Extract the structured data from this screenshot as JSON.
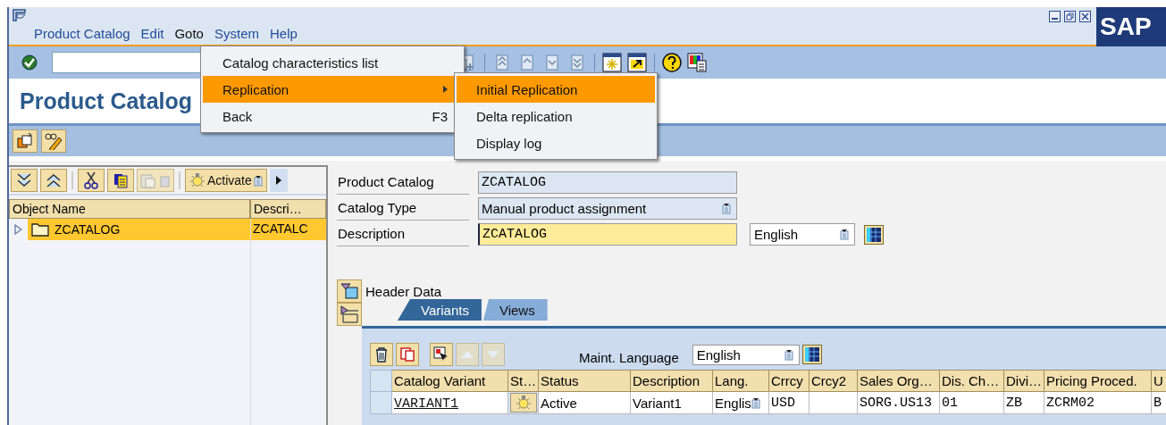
{
  "menu_bar": [
    {
      "label": "Product Catalog",
      "selected": false
    },
    {
      "label": "Edit",
      "selected": false
    },
    {
      "label": "Goto",
      "selected": true
    },
    {
      "label": "System",
      "selected": false
    },
    {
      "label": "Help",
      "selected": false
    }
  ],
  "goto_menu": [
    {
      "label": "Catalog characteristics list",
      "selected": false
    },
    {
      "label": "Replication",
      "selected": true,
      "kind": "submenu"
    },
    {
      "label": "Back",
      "shortcut": "F3",
      "selected": false
    }
  ],
  "replication_menu": [
    {
      "label": "Initial Replication",
      "selected": true
    },
    {
      "label": "Delta replication",
      "selected": false
    },
    {
      "label": "Display log",
      "selected": false
    }
  ],
  "logo": "SAP",
  "page_title": "Product Catalog",
  "tree": {
    "toolbar_button": "Activate",
    "columns": [
      "Object Name",
      "Descri…"
    ],
    "rows": [
      {
        "name": "ZCATALOG",
        "description": "ZCATALC",
        "selected": true,
        "expanded": false
      }
    ]
  },
  "form": [
    {
      "label": "Product Catalog",
      "value": "ZCATALOG",
      "kind": "display"
    },
    {
      "label": "Catalog Type",
      "value": "Manual product assignment",
      "kind": "dropdown"
    },
    {
      "label": "Description",
      "value": "ZCATALOG",
      "kind": "input",
      "language": "English"
    }
  ],
  "header_data": "Header Data",
  "tabs": [
    {
      "label": "Variants",
      "selected": true
    },
    {
      "label": "Views",
      "selected": false
    }
  ],
  "maint_language": {
    "label": "Maint. Language",
    "value": "English"
  },
  "table": {
    "columns": [
      "Catalog Variant",
      "St…",
      "Status",
      "Description",
      "Lang.",
      "Crrcy",
      "Crcy2",
      "Sales Org…",
      "Dis. Ch…",
      "Divi…",
      "Pricing Proced.",
      "U"
    ],
    "rows": [
      [
        {
          "kind": "link",
          "text": "VARIANT1"
        },
        {
          "kind": "bulb"
        },
        {
          "kind": "text",
          "text": "Active"
        },
        {
          "kind": "text",
          "text": "Variant1"
        },
        {
          "kind": "dropdown",
          "text": "Englis"
        },
        {
          "kind": "mono",
          "text": "USD"
        },
        {
          "kind": "empty"
        },
        {
          "kind": "mono",
          "text": "SORG.US13"
        },
        {
          "kind": "mono",
          "text": "01"
        },
        {
          "kind": "mono",
          "text": "ZB"
        },
        {
          "kind": "mono",
          "text": "ZCRM02"
        },
        {
          "kind": "mono",
          "text": "B"
        }
      ]
    ]
  }
}
